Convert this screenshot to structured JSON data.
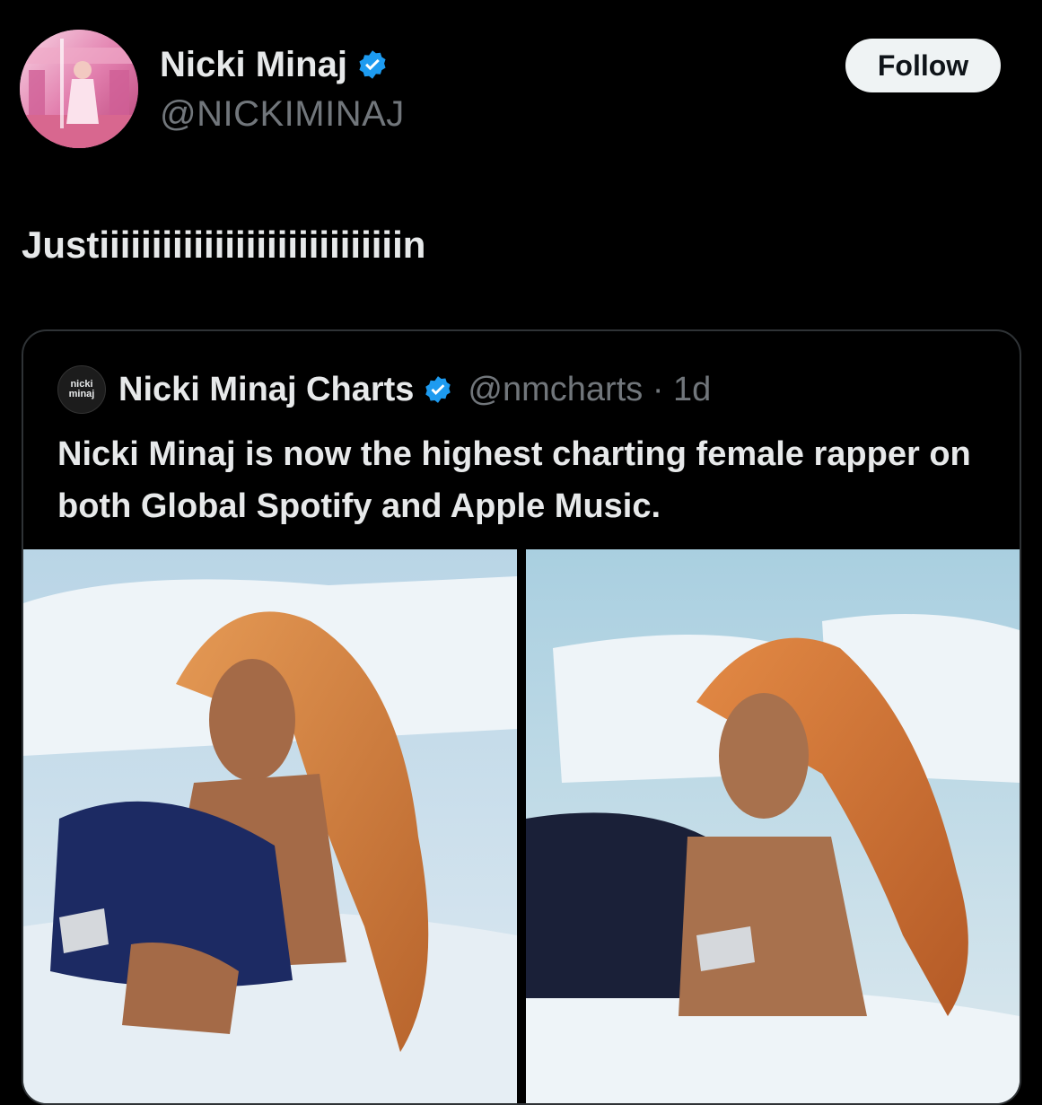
{
  "author": {
    "name": "Nicki Minaj",
    "handle": "@NICKIMINAJ",
    "verified": true
  },
  "follow_label": "Follow",
  "tweet": {
    "text": "Justiiiiiiiiiiiiiiiiiiiiiiiiiiiiin"
  },
  "quoted_tweet": {
    "avatar_text_top": "nicki",
    "avatar_text_bottom": "minaj",
    "name": "Nicki Minaj Charts",
    "handle_time": "@nmcharts · 1d",
    "verified": true,
    "text": "Nicki Minaj is now the highest charting female rapper on both Global Spotify and Apple Music.",
    "media": [
      {
        "icon": "photo"
      },
      {
        "icon": "photo"
      }
    ]
  },
  "colors": {
    "background": "#000000",
    "verified_blue": "#1d9bf0",
    "text_primary": "#e7e9ea",
    "text_secondary": "#71767b",
    "follow_button_bg": "#eff3f4"
  }
}
